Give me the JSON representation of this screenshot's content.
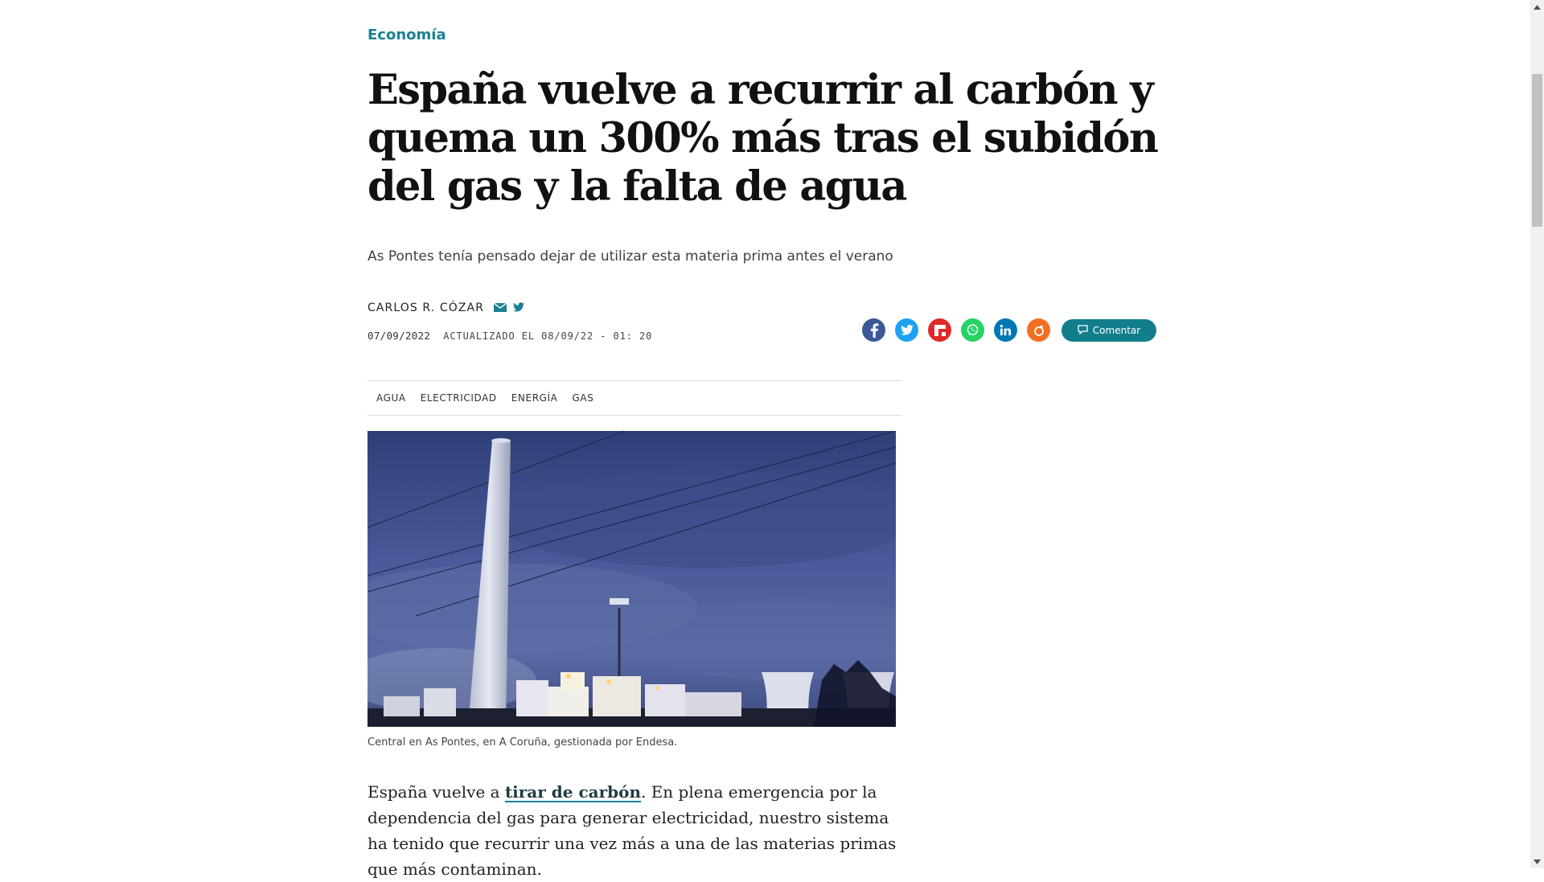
{
  "section": "Economía",
  "headline": "España vuelve a recurrir al carbón y quema un 300% más tras el subidón del gas y la falta de agua",
  "subtitle": "As Pontes tenía pensado dejar de utilizar esta materia prima antes el verano",
  "author": {
    "name": "CARLOS R. CÓZAR",
    "icons": [
      "mail-icon",
      "twitter-icon"
    ]
  },
  "date": "07/09/2022",
  "updated": "ACTUALIZADO EL 08/09/22 - 01: 20",
  "share": {
    "buttons": [
      {
        "name": "facebook-icon",
        "color": "#3b5998"
      },
      {
        "name": "twitter-icon",
        "color": "#1da1f2"
      },
      {
        "name": "flipboard-icon",
        "color": "#e12828"
      },
      {
        "name": "whatsapp-icon",
        "color": "#25d366"
      },
      {
        "name": "linkedin-icon",
        "color": "#0077b5"
      },
      {
        "name": "meneame-icon",
        "color": "#f26f20"
      }
    ],
    "comment_label": "Comentar",
    "comment_color": "#127e8c"
  },
  "tags": [
    "AGUA",
    "ELECTRICIDAD",
    "ENERGÍA",
    "GAS"
  ],
  "caption": "Central en As Pontes, en A Coruña, gestionada por Endesa.",
  "body": {
    "before_link": "España vuelve a ",
    "link_text": "tirar de carbón",
    "after_link": ". En plena emergencia por la dependencia del gas para generar electricidad, nuestro sistema ha tenido que recurrir una vez más a una de las materias primas que más contaminan."
  },
  "colors": {
    "accent": "#1b8093",
    "headline": "#111111"
  }
}
